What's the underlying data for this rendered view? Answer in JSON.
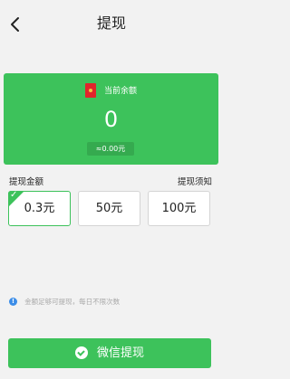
{
  "header": {
    "title": "提现",
    "back_icon": "chevron-left-icon"
  },
  "balance": {
    "label": "当前余额",
    "value": "0",
    "approx": "≈0.00元",
    "icon": "red-envelope-icon",
    "card_color": "#3dc25b"
  },
  "amount_section": {
    "label": "提现金额",
    "notice": "提现须知",
    "options": [
      {
        "label": "0.3元",
        "selected": true
      },
      {
        "label": "50元",
        "selected": false
      },
      {
        "label": "100元",
        "selected": false
      }
    ],
    "selected_check": "✓"
  },
  "tip": {
    "icon": "info-icon",
    "icon_glyph": "!",
    "text": "金额足够可提现，每日不限次数"
  },
  "withdraw_button": {
    "icon": "wechat-icon",
    "label": "微信提现",
    "color": "#3dc25b"
  }
}
